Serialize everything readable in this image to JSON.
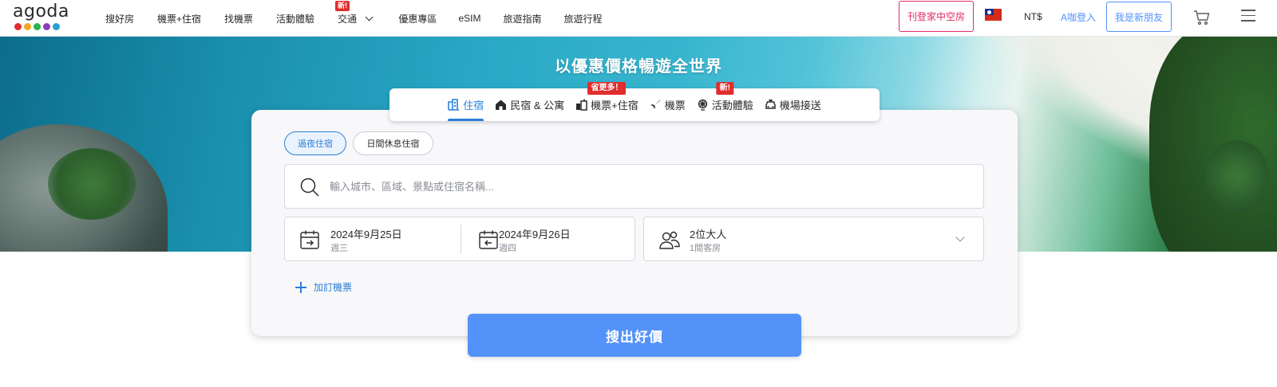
{
  "header": {
    "logo_text": "agoda",
    "logo_dot_colors": [
      "#e12d2d",
      "#f5a623",
      "#2db34a",
      "#8b3fb4",
      "#2a9fd8"
    ],
    "nav": [
      {
        "label": "搜好房"
      },
      {
        "label": "機票+住宿"
      },
      {
        "label": "找機票"
      },
      {
        "label": "活動體驗"
      },
      {
        "label": "交通",
        "badge": "新!"
      },
      {
        "label": "優惠專區"
      },
      {
        "label": "eSIM"
      },
      {
        "label": "旅遊指南"
      },
      {
        "label": "旅遊行程"
      }
    ],
    "list_property_label": "刊登家中空房",
    "currency": "NT$",
    "login_label": "A咖登入",
    "signup_label": "我是新朋友"
  },
  "hero": {
    "title": "以優惠價格暢遊全世界"
  },
  "tabs": [
    {
      "label": "住宿",
      "icon": "hotel-icon",
      "active": true
    },
    {
      "label": "民宿 & 公寓",
      "icon": "home-icon"
    },
    {
      "label": "機票+住宿",
      "icon": "flight-hotel-icon",
      "badge": "省更多！"
    },
    {
      "label": "機票",
      "icon": "plane-icon"
    },
    {
      "label": "活動體驗",
      "icon": "ferris-wheel-icon",
      "badge": "新!"
    },
    {
      "label": "機場接送",
      "icon": "car-icon"
    }
  ],
  "stay_type": {
    "overnight_label": "過夜住宿",
    "dayuse_label": "日間休息住宿"
  },
  "search": {
    "placeholder": "輸入城市、區域、景點或住宿名稱...",
    "value": ""
  },
  "dates": {
    "checkin_date": "2024年9月25日",
    "checkin_day": "週三",
    "checkout_date": "2024年9月26日",
    "checkout_day": "週四"
  },
  "guests": {
    "summary": "2位大人",
    "rooms": "1間客房"
  },
  "add_flight_label": "加訂機票",
  "search_button_label": "搜出好價",
  "colors": {
    "accent_blue": "#5392f9",
    "tab_active": "#2a7fd8",
    "badge_red": "#e12d2d",
    "list_property_pink": "#e12d61"
  }
}
